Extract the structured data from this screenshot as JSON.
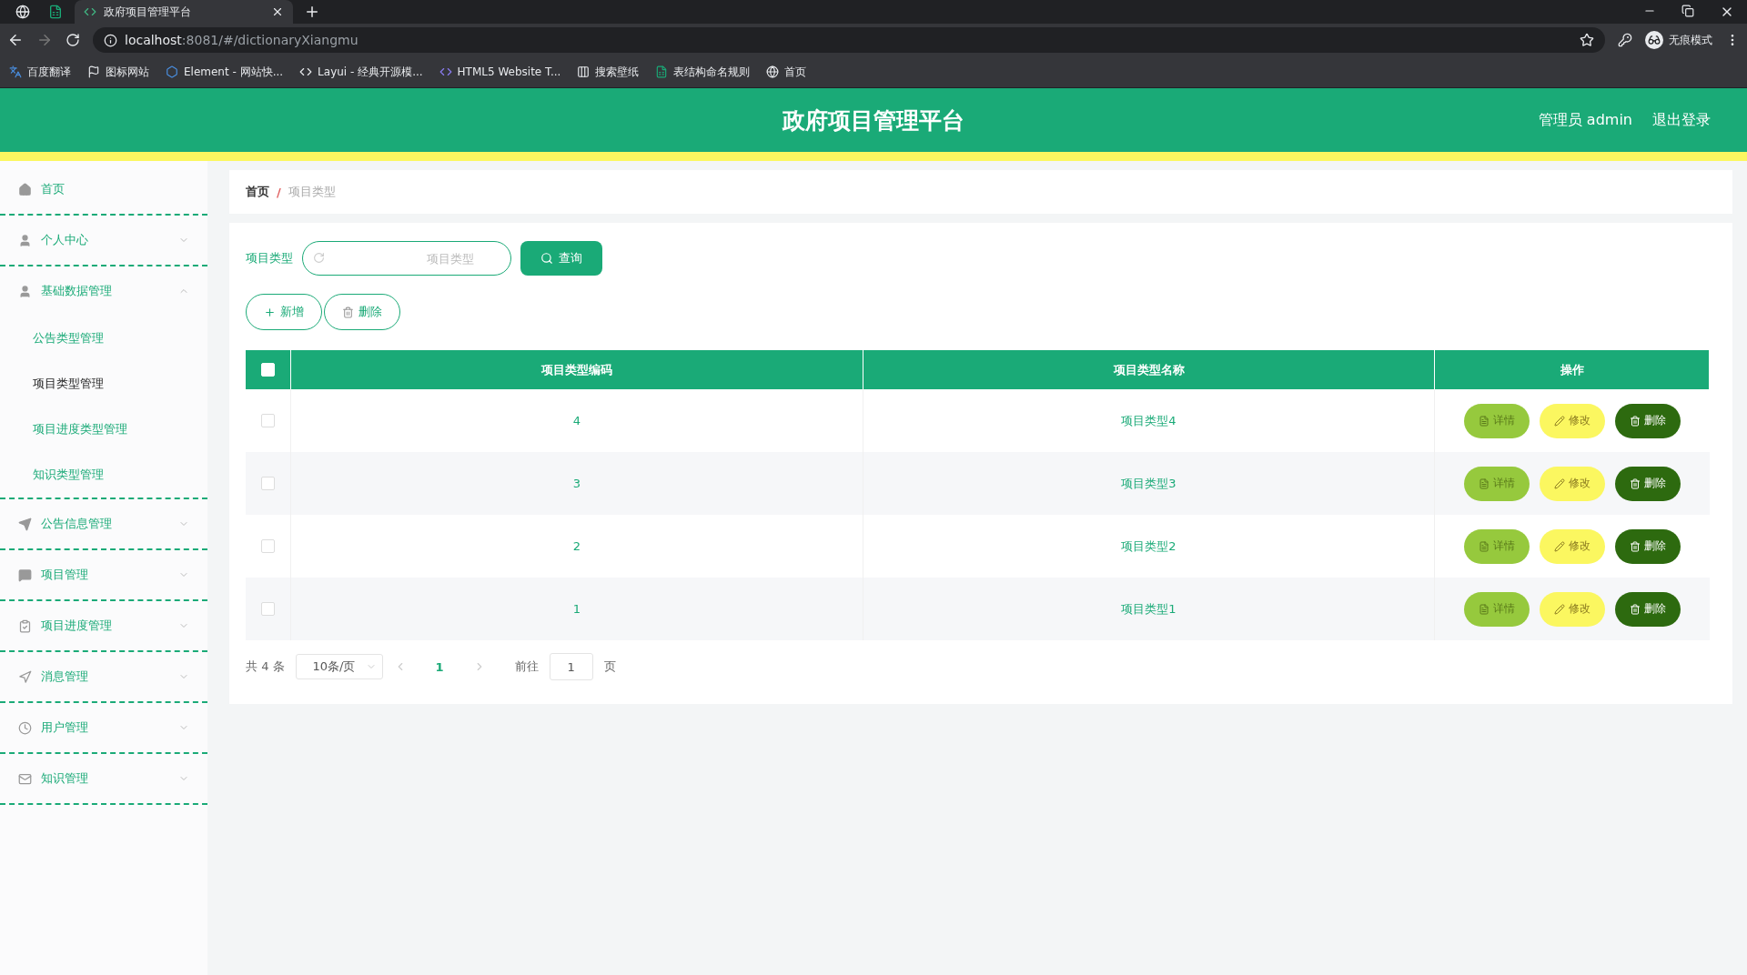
{
  "browser": {
    "tabs": [
      {
        "title": "政府项目管理平台",
        "selected": true
      }
    ],
    "url": {
      "host": "localhost",
      "rest": ":8081/#/dictionaryXiangmu"
    },
    "profile": "无痕模式",
    "bookmarks": [
      {
        "label": "百度翻译",
        "kind": "translate"
      },
      {
        "label": "图标网站",
        "kind": "flag"
      },
      {
        "label": "Element - 网站快...",
        "kind": "hex"
      },
      {
        "label": "Layui - 经典开源模...",
        "kind": "layui"
      },
      {
        "label": "HTML5 Website T...",
        "kind": "html"
      },
      {
        "label": "搜索壁纸",
        "kind": "wall"
      },
      {
        "label": "表结构命名规则",
        "kind": "sheet"
      },
      {
        "label": "首页",
        "kind": "globe"
      }
    ]
  },
  "header": {
    "title": "政府项目管理平台",
    "user": "管理员 admin",
    "logout": "退出登录"
  },
  "sidebar": {
    "items": [
      {
        "label": "首页",
        "kind": "home"
      },
      {
        "label": "个人中心",
        "kind": "user",
        "expanded": false
      },
      {
        "label": "基础数据管理",
        "kind": "user",
        "expanded": true,
        "children": [
          {
            "label": "公告类型管理",
            "selected": false
          },
          {
            "label": "项目类型管理",
            "selected": true
          },
          {
            "label": "项目进度类型管理",
            "selected": false
          },
          {
            "label": "知识类型管理",
            "selected": false
          }
        ]
      },
      {
        "label": "公告信息管理",
        "kind": "send",
        "expanded": false
      },
      {
        "label": "项目管理",
        "kind": "chat",
        "expanded": false
      },
      {
        "label": "项目进度管理",
        "kind": "clipboard",
        "expanded": false
      },
      {
        "label": "消息管理",
        "kind": "nav",
        "expanded": false
      },
      {
        "label": "用户管理",
        "kind": "clock",
        "expanded": false
      },
      {
        "label": "知识管理",
        "kind": "mail",
        "expanded": false
      }
    ]
  },
  "breadcrumb": {
    "items": [
      "首页",
      "项目类型"
    ],
    "separator": "/"
  },
  "search": {
    "label": "项目类型",
    "placeholder": "项目类型",
    "button": "查询"
  },
  "actions": [
    {
      "label": "新增",
      "kind": "add"
    },
    {
      "label": "删除",
      "kind": "delete"
    }
  ],
  "table": {
    "all_checked": false,
    "columns": [
      "项目类型编码",
      "项目类型名称",
      "操作"
    ],
    "rows": [
      {
        "checked": false,
        "code": "4",
        "name": "项目类型4",
        "actions": [
          {
            "label": "详情",
            "kind": "detail"
          },
          {
            "label": "修改",
            "kind": "edit"
          },
          {
            "label": "删除",
            "kind": "delete"
          }
        ]
      },
      {
        "checked": false,
        "code": "3",
        "name": "项目类型3",
        "actions": [
          {
            "label": "详情",
            "kind": "detail"
          },
          {
            "label": "修改",
            "kind": "edit"
          },
          {
            "label": "删除",
            "kind": "delete"
          }
        ]
      },
      {
        "checked": false,
        "code": "2",
        "name": "项目类型2",
        "actions": [
          {
            "label": "详情",
            "kind": "detail"
          },
          {
            "label": "修改",
            "kind": "edit"
          },
          {
            "label": "删除",
            "kind": "delete"
          }
        ]
      },
      {
        "checked": false,
        "code": "1",
        "name": "项目类型1",
        "actions": [
          {
            "label": "详情",
            "kind": "detail"
          },
          {
            "label": "修改",
            "kind": "edit"
          },
          {
            "label": "删除",
            "kind": "delete"
          }
        ]
      }
    ]
  },
  "pagination": {
    "total": "共 4 条",
    "size": "10条/页",
    "pages": [
      {
        "label": "1",
        "selected": true
      }
    ],
    "goto": "前往",
    "goto_value": "1",
    "unit": "页"
  }
}
